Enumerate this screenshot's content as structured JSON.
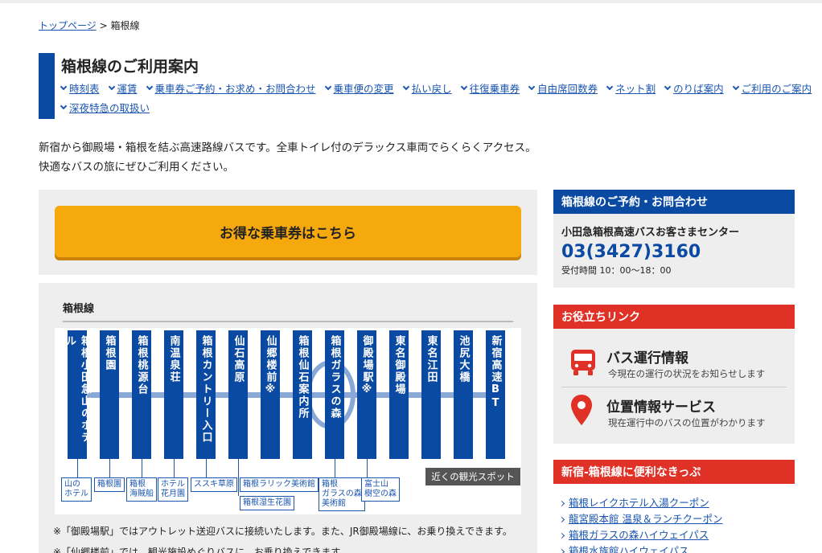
{
  "breadcrumb": {
    "home": "トップページ",
    "sep": ">",
    "current": "箱根線"
  },
  "header": {
    "title": "箱根線のご利用案内",
    "nav_row1": [
      "時刻表",
      "運賃",
      "乗車券ご予約・お求め・お問合わせ",
      "乗車便の変更",
      "払い戻し",
      "往復乗車券",
      "自由席回数券",
      "ネット割",
      "のりば案内",
      "ご利用のご案内"
    ],
    "nav_row2": [
      "深夜特急の取扱い"
    ]
  },
  "intro": "新宿から御殿場・箱根を結ぶ高速路線バスです。全車トイレ付のデラックス車両でらくらくアクセス。快適なバスの旅にぜひご利用ください。",
  "cta": {
    "label": "お得な乗車券はこちら"
  },
  "route": {
    "label": "箱根線",
    "stops": [
      "箱根小田急山のホテル",
      "箱根園",
      "箱根桃源台",
      "南温泉荘",
      "箱根カントリー入口",
      "仙石高原",
      "仙郷楼前※",
      "箱根仙石案内所",
      "箱根ガラスの森",
      "御殿場駅※",
      "東名御殿場",
      "東名江田",
      "池尻大橋",
      "新宿高速BT"
    ],
    "spot_tag": "近くの観光スポット",
    "spots": [
      "山の\nホテル",
      "箱根園",
      "箱根\n海賊船",
      "ホテル\n花月園",
      "ススキ草原",
      "箱根ラリック美術館",
      "箱根湿生花園",
      "箱根\nガラスの森\n美術館",
      "富士山\n樹空の森"
    ]
  },
  "notes": [
    "※「御殿場駅」ではアウトレット送迎バスに接続いたします。また、JR御殿場線に、お乗り換えできます。",
    "※「仙郷楼前」では、観光施設めぐりバスに、お乗り換えできます。"
  ],
  "sidebar": {
    "contact": {
      "heading": "箱根線のご予約・お問合わせ",
      "center": "小田急箱根高速バスお客さまセンター",
      "phone": "03(3427)3160",
      "hours": "受付時間 10：00〜18：00"
    },
    "useful": {
      "heading": "お役立ちリンク",
      "bus_title": "バス運行情報",
      "bus_desc": "今現在の運行の状況をお知らせします",
      "loc_title": "位置情報サービス",
      "loc_desc": "現在運行中のバスの位置がわかります"
    },
    "tickets": {
      "heading": "新宿-箱根線に便利なきっぷ",
      "links": [
        "箱根レイクホテル入湯クーポン",
        "龍宮殿本館 温泉＆ランチクーポン",
        "箱根ガラスの森ハイウェイパス",
        "箱根水族館ハイウェイパス"
      ]
    }
  },
  "colors": {
    "brand_blue": "#0b4aa3",
    "link_blue": "#1a55b0",
    "accent_red": "#e03127",
    "cta_orange": "#f5a90d"
  }
}
